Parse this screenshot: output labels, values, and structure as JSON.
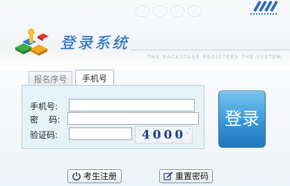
{
  "header": {
    "title": "登录系统",
    "subtitle": "THE BACKSTAGE REGISTERS THE SYSTEM"
  },
  "tabs": [
    {
      "label": "报名序号",
      "active": false
    },
    {
      "label": "手机号",
      "active": true
    }
  ],
  "form": {
    "phone_label": "手机号:",
    "password_label": "密    码:",
    "captcha_label": "验证码:",
    "phone_value": "",
    "password_value": "",
    "captcha_value": "",
    "captcha_image_text": "4000"
  },
  "buttons": {
    "login": "登录",
    "register": "考生注册",
    "reset_password": "重置密码"
  },
  "colors": {
    "accent": "#2f88cf",
    "title": "#1c66b9",
    "form_bg": "#e5f2f8"
  }
}
